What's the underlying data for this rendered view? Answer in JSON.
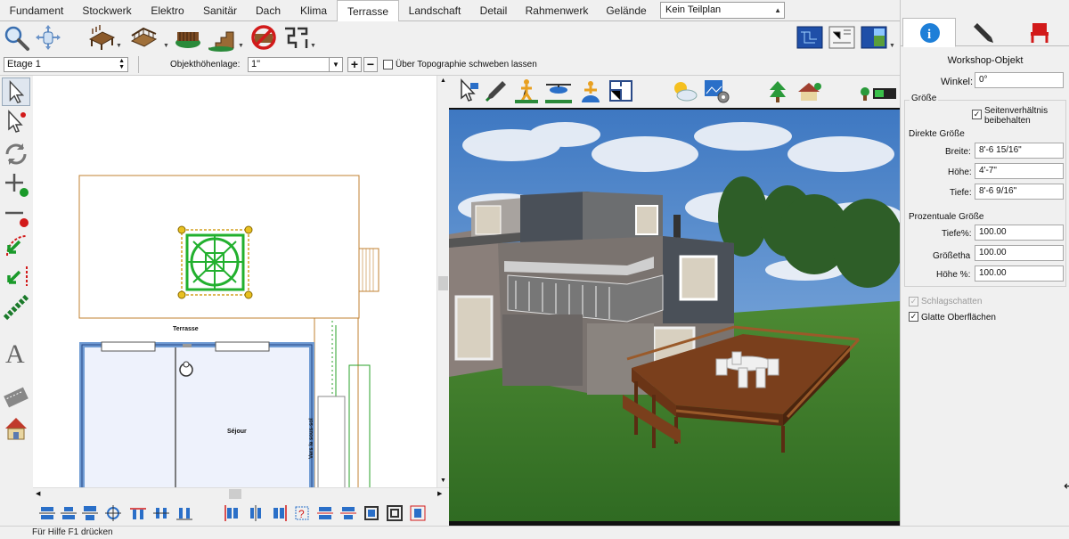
{
  "tabs": [
    {
      "label": "Fundament",
      "active": false
    },
    {
      "label": "Stockwerk",
      "active": false
    },
    {
      "label": "Elektro",
      "active": false
    },
    {
      "label": "Sanitär",
      "active": false
    },
    {
      "label": "Dach",
      "active": false
    },
    {
      "label": "Klima",
      "active": false
    },
    {
      "label": "Terrasse",
      "active": true
    },
    {
      "label": "Landschaft",
      "active": false
    },
    {
      "label": "Detail",
      "active": false
    },
    {
      "label": "Rahmenwerk",
      "active": false
    },
    {
      "label": "Gelände",
      "active": false
    }
  ],
  "teilplan_select": {
    "value": "Kein Teilplan"
  },
  "toolbar2": {
    "etage_select": "Etage 1",
    "objekthoehe_label": "Objekthöhenlage:",
    "objekthoehe_value": "1\"",
    "topo_checkbox_label": "Über Topographie schweben lassen",
    "topo_checked": false,
    "plus_label": "+",
    "minus_label": "−"
  },
  "plan": {
    "terrace_label": "Terrasse",
    "room_label": "Séjour",
    "stair_label": "Vers le sous-sol"
  },
  "panel": {
    "title": "Workshop-Objekt",
    "winkel_label": "Winkel:",
    "winkel_value": "0°",
    "groesse_heading": "Größe",
    "seitenverhaeltnis_label_1": "Seitenverhältnis",
    "seitenverhaeltnis_label_2": "beibehalten",
    "seitenverhaeltnis_checked": true,
    "direkte_heading": "Direkte Größe",
    "breite_label": "Breite:",
    "breite_value": "8'-6 15/16\"",
    "hoehe_label": "Höhe:",
    "hoehe_value": "4'-7\"",
    "tiefe_label": "Tiefe:",
    "tiefe_value": "8'-6 9/16\"",
    "prozent_heading": "Prozentuale Größe",
    "tiefe_pct_label": "Tiefe%:",
    "tiefe_pct_value": "100.00",
    "groessetha_label": "Größetha",
    "groessetha_value": "100.00",
    "hoehe_pct_label": "Höhe %:",
    "hoehe_pct_value": "100.00",
    "schlagschatten_label": "Schlagschatten",
    "schlagschatten_checked": true,
    "glatte_label": "Glatte Oberflächen",
    "glatte_checked": true
  },
  "status_text": "Für Hilfe F1 drücken",
  "colors": {
    "accent_blue": "#1e7fd8",
    "selection_green": "#22b02e",
    "wall_blue": "#6f9bd3",
    "terrace_outline": "#c08030"
  }
}
